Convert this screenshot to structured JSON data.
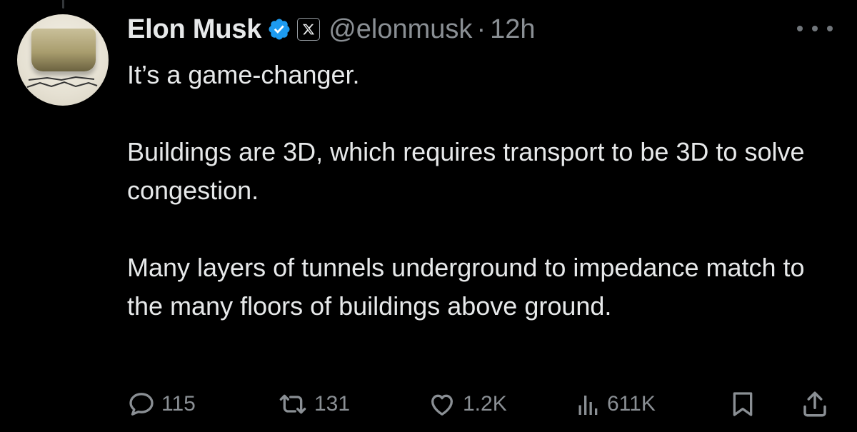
{
  "tweet": {
    "author_name": "Elon Musk",
    "handle": "@elonmusk",
    "separator": "·",
    "time": "12h",
    "paragraphs": [
      "It’s a game-changer.",
      "Buildings are 3D, which requires transport to be 3D to solve congestion.",
      "Many layers of tunnels underground to impedance match to the many floors of buildings above ground."
    ]
  },
  "actions": {
    "replies": "115",
    "reposts": "131",
    "likes": "1.2K",
    "views": "611K"
  },
  "icons": {
    "verified": "verified-badge-icon",
    "affiliation": "x-logo-icon",
    "more": "more-options-icon",
    "reply": "reply-icon",
    "repost": "repost-icon",
    "like": "heart-icon",
    "views": "views-chart-icon",
    "bookmark": "bookmark-icon",
    "share": "share-icon"
  },
  "colors": {
    "background": "#000000",
    "text": "#e7e9ea",
    "muted": "#8a8f94",
    "verified_blue": "#1d9bf0"
  }
}
